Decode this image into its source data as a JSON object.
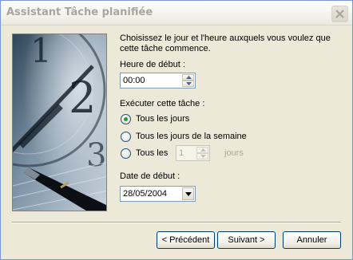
{
  "window": {
    "title": "Assistant Tâche planifiée"
  },
  "intro": "Choisissez le jour et l'heure auxquels vous voulez que cette tâche commence.",
  "start_time": {
    "label": "Heure de début :",
    "value": "00:00"
  },
  "run": {
    "label": "Exécuter cette tâche :",
    "options": [
      {
        "label": "Tous les jours",
        "selected": true
      },
      {
        "label": "Tous les jours de la semaine",
        "selected": false
      },
      {
        "label": "Tous les",
        "selected": false
      }
    ],
    "every_n_days": {
      "value": "1",
      "suffix": "jours",
      "enabled": false
    }
  },
  "start_date": {
    "label": "Date de début :",
    "value": "28/05/2004"
  },
  "buttons": {
    "back": "< Précédent",
    "next": "Suivant >",
    "cancel": "Annuler"
  },
  "icons": {
    "close": "close-icon",
    "spin_up": "arrow-up-icon",
    "spin_down": "arrow-down-icon",
    "dropdown": "chevron-down-icon"
  },
  "colors": {
    "selected_radio": "#21a121",
    "title_text": "#a7a69c",
    "window_bg": "#ece9d8"
  }
}
